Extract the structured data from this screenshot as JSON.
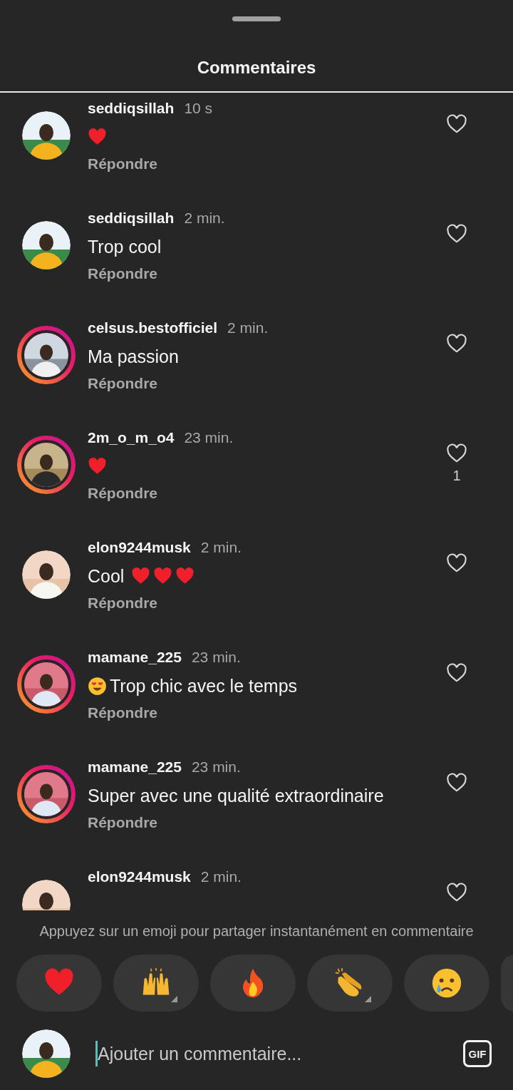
{
  "sheet": {
    "title": "Commentaires"
  },
  "comments": [
    {
      "username": "seddiqsillah",
      "time": "10 s",
      "story_ring": false,
      "body": [
        {
          "kind": "heart"
        }
      ],
      "reply": "Répondre"
    },
    {
      "username": "seddiqsillah",
      "time": "2 min.",
      "story_ring": false,
      "body": [
        {
          "kind": "text",
          "text": "Trop cool"
        }
      ],
      "reply": "Répondre"
    },
    {
      "username": "celsus.bestofficiel",
      "time": "2 min.",
      "story_ring": true,
      "body": [
        {
          "kind": "text",
          "text": "Ma passion"
        }
      ],
      "reply": "Répondre"
    },
    {
      "username": "2m_o_m_o4",
      "time": "23 min.",
      "story_ring": true,
      "body": [
        {
          "kind": "heart"
        }
      ],
      "reply": "Répondre",
      "likes": "1"
    },
    {
      "username": "elon9244musk",
      "time": "2 min.",
      "story_ring": false,
      "body": [
        {
          "kind": "text",
          "text": "Cool"
        },
        {
          "kind": "heart"
        },
        {
          "kind": "heart"
        },
        {
          "kind": "heart"
        }
      ],
      "reply": "Répondre"
    },
    {
      "username": "mamane_225",
      "time": "23 min.",
      "story_ring": true,
      "body": [
        {
          "kind": "hearteyes"
        },
        {
          "kind": "text",
          "text": "Trop chic avec le temps"
        }
      ],
      "reply": "Répondre"
    },
    {
      "username": "mamane_225",
      "time": "23 min.",
      "story_ring": true,
      "body": [
        {
          "kind": "text",
          "text": "Super avec une qualité extraordinaire"
        }
      ],
      "reply": "Répondre"
    },
    {
      "username": "elon9244musk",
      "time": "2 min.",
      "story_ring": false
    }
  ],
  "emoji_bar": {
    "hint": "Appuyez sur un emoji pour partager instantanément en commentaire",
    "emojis": [
      {
        "kind": "heart",
        "has_variants": false
      },
      {
        "kind": "hands",
        "has_variants": true
      },
      {
        "kind": "fire",
        "has_variants": false
      },
      {
        "kind": "clap",
        "has_variants": true
      },
      {
        "kind": "crying",
        "has_variants": false
      }
    ]
  },
  "composer": {
    "placeholder": "Ajouter un commentaire...",
    "gif_label": "GIF"
  }
}
